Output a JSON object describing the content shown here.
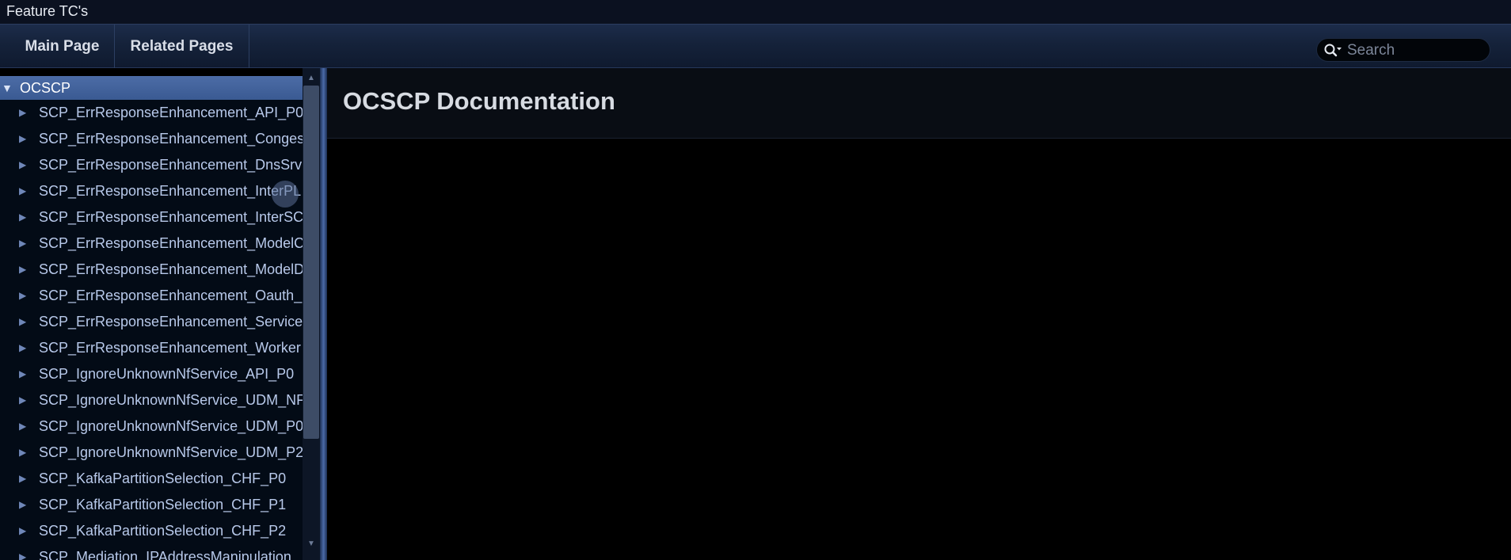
{
  "window": {
    "title": "Feature TC's"
  },
  "nav": {
    "tabs": [
      {
        "label": "Main Page"
      },
      {
        "label": "Related Pages"
      }
    ],
    "search": {
      "placeholder": "Search",
      "value": ""
    }
  },
  "sidebar": {
    "root": {
      "label": "OCSCP",
      "expanded": true
    },
    "items": [
      {
        "label": "SCP_ErrResponseEnhancement_API_P0"
      },
      {
        "label": "SCP_ErrResponseEnhancement_Conges"
      },
      {
        "label": "SCP_ErrResponseEnhancement_DnsSrv"
      },
      {
        "label": "SCP_ErrResponseEnhancement_InterPL"
      },
      {
        "label": "SCP_ErrResponseEnhancement_InterSC"
      },
      {
        "label": "SCP_ErrResponseEnhancement_ModelC"
      },
      {
        "label": "SCP_ErrResponseEnhancement_ModelD"
      },
      {
        "label": "SCP_ErrResponseEnhancement_Oauth_"
      },
      {
        "label": "SCP_ErrResponseEnhancement_Service"
      },
      {
        "label": "SCP_ErrResponseEnhancement_Worker"
      },
      {
        "label": "SCP_IgnoreUnknownNfService_API_P0"
      },
      {
        "label": "SCP_IgnoreUnknownNfService_UDM_NF"
      },
      {
        "label": "SCP_IgnoreUnknownNfService_UDM_P0"
      },
      {
        "label": "SCP_IgnoreUnknownNfService_UDM_P2"
      },
      {
        "label": "SCP_KafkaPartitionSelection_CHF_P0"
      },
      {
        "label": "SCP_KafkaPartitionSelection_CHF_P1"
      },
      {
        "label": "SCP_KafkaPartitionSelection_CHF_P2"
      },
      {
        "label": "SCP_Mediation_IPAddressManipulation_"
      }
    ]
  },
  "main": {
    "title": "OCSCP Documentation"
  },
  "colors": {
    "accent": "#4c6ca6",
    "background": "#000000",
    "nav": "#15223a"
  }
}
